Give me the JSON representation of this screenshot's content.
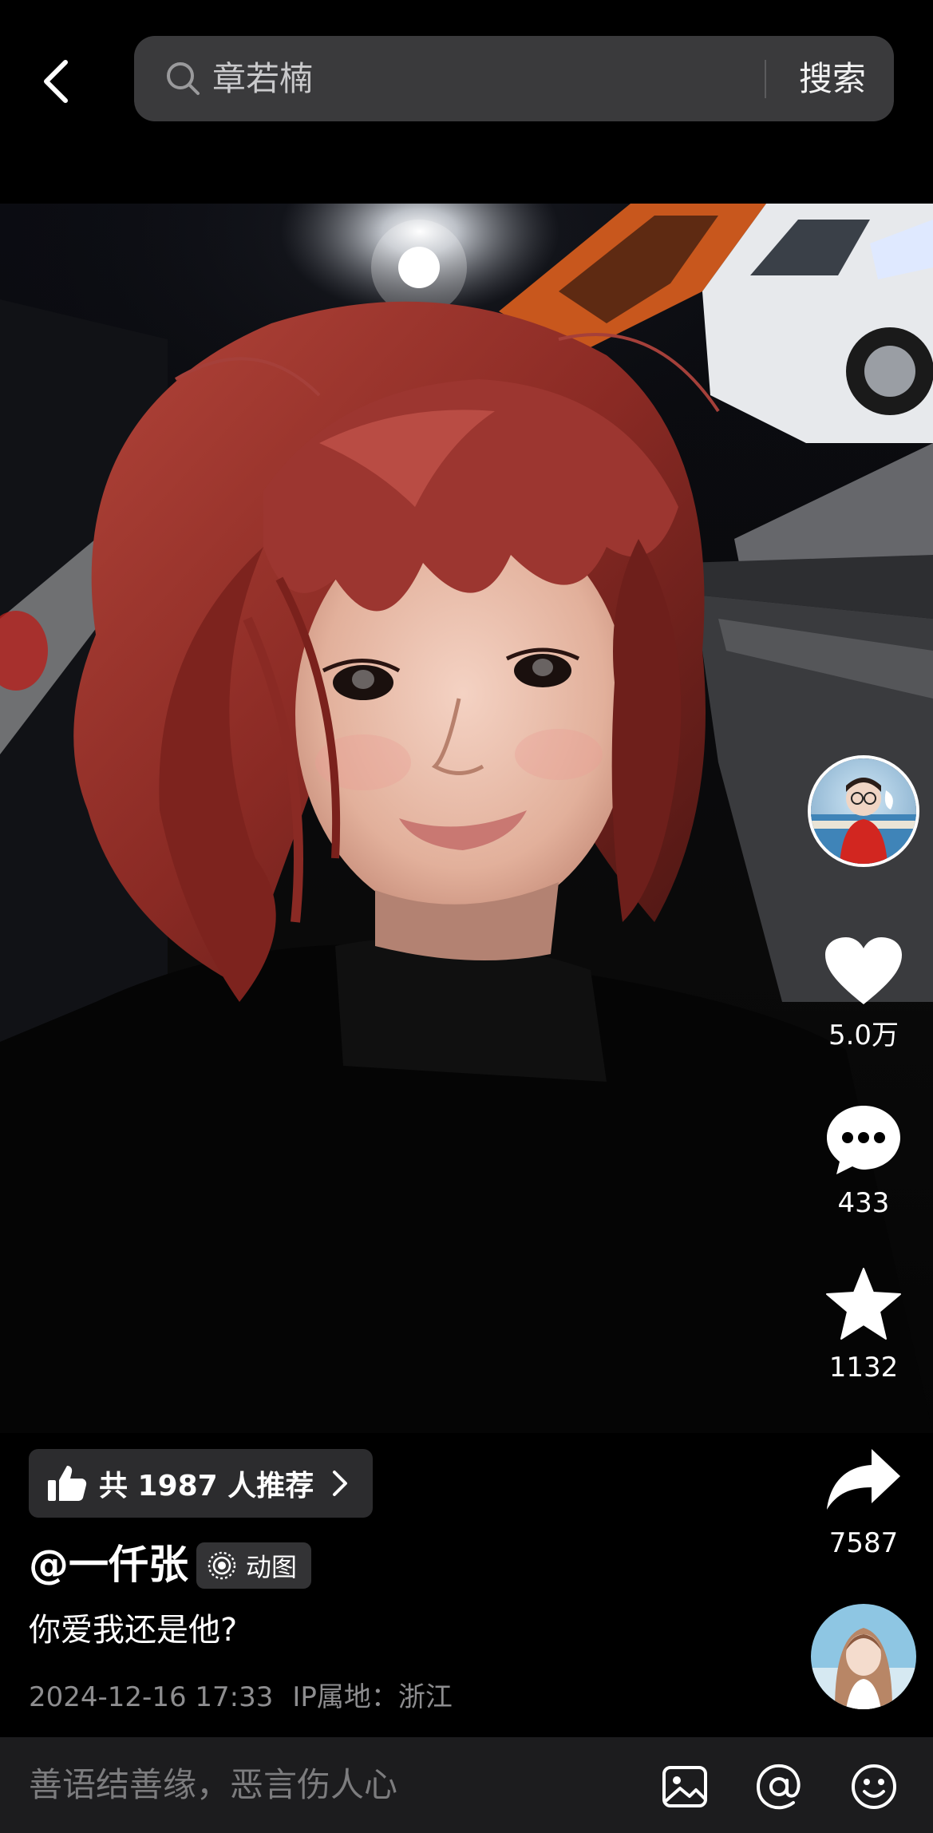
{
  "header": {
    "back_icon": "chevron-left-icon",
    "search": {
      "icon": "search-icon",
      "value": "章若楠",
      "button_label": "搜索"
    }
  },
  "post": {
    "recommend": {
      "icon": "thumbs-up-icon",
      "label": "共 1987 人推荐",
      "chevron": "chevron-right-icon"
    },
    "author": "@一仟张",
    "type_badge": {
      "icon": "live-photo-icon",
      "label": "动图"
    },
    "caption": "你爱我还是他?",
    "date": "2024-12-16 17:33",
    "ip_location": "IP属地：浙江"
  },
  "actions": {
    "like": {
      "icon": "heart-icon",
      "count": "5.0万"
    },
    "comment": {
      "icon": "comment-dots-icon",
      "count": "433"
    },
    "favorite": {
      "icon": "star-icon",
      "count": "1132"
    },
    "share": {
      "icon": "share-arrow-icon",
      "count": "7587"
    }
  },
  "comment_bar": {
    "placeholder": "善语结善缘，恶言伤人心",
    "icons": [
      "image-icon",
      "at-icon",
      "emoji-icon"
    ]
  },
  "colors": {
    "background": "#000000",
    "search_bg": "#3a3a3c",
    "chip_bg": "#2c2c2e",
    "comment_bar_bg": "#1c1c1e",
    "meta_text": "#8d8d8f"
  }
}
